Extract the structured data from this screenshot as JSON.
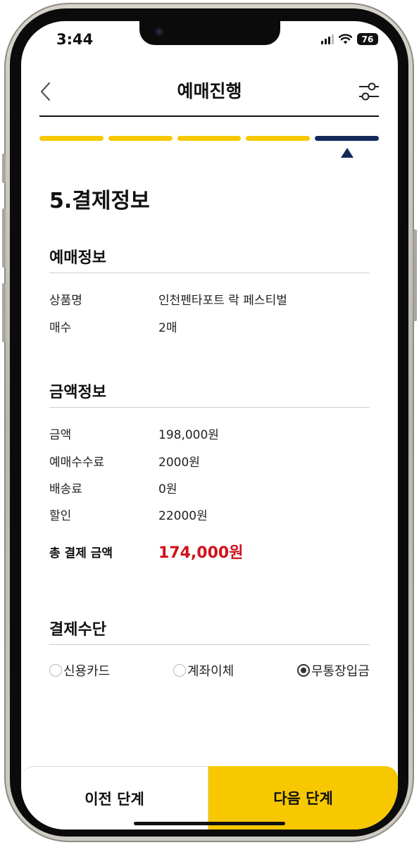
{
  "status_bar": {
    "time": "3:44",
    "battery": "76"
  },
  "header": {
    "title": "예매진행"
  },
  "progress": {
    "total_steps": 5,
    "current_step": 5,
    "completed_color": "#f7c800",
    "current_color": "#13295a"
  },
  "page_heading": "5.결제정보",
  "booking_info": {
    "title": "예매정보",
    "rows": [
      {
        "label": "상품명",
        "value": "인천펜타포트 락 페스티벌"
      },
      {
        "label": "매수",
        "value": "2매"
      }
    ]
  },
  "amount_info": {
    "title": "금액정보",
    "rows": [
      {
        "label": "금액",
        "value": "198,000원"
      },
      {
        "label": "예매수수료",
        "value": "2000원"
      },
      {
        "label": "배송료",
        "value": "0원"
      },
      {
        "label": "할인",
        "value": "22000원"
      }
    ],
    "total_label": "총 결제 금액",
    "total_value": "174,000원",
    "total_color": "#d0121b"
  },
  "payment_method": {
    "title": "결제수단",
    "options": [
      {
        "label": "신용카드",
        "selected": false
      },
      {
        "label": "계좌이체",
        "selected": false
      },
      {
        "label": "무통장입금",
        "selected": true
      }
    ]
  },
  "footer": {
    "prev_label": "이전 단계",
    "next_label": "다음 단계",
    "next_color": "#f7c800"
  }
}
